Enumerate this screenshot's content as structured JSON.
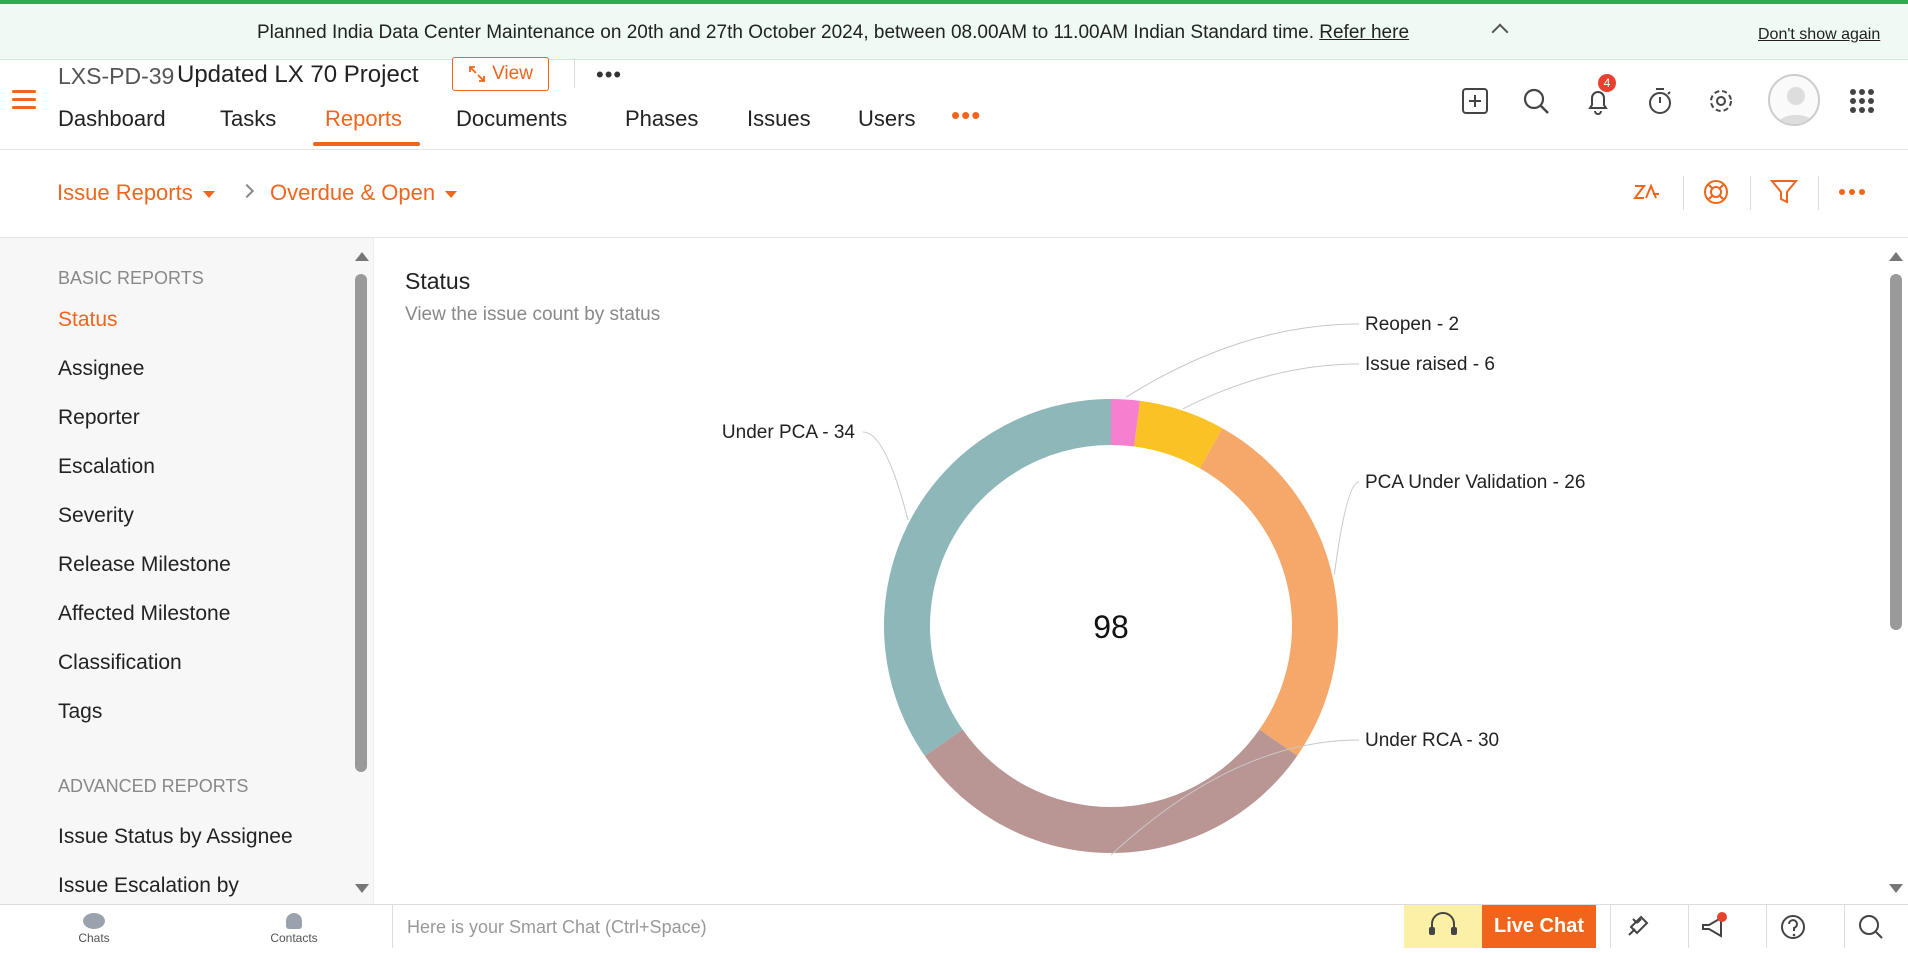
{
  "banner": {
    "message": "Planned India Data Center Maintenance on 20th and 27th October 2024, between 08.00AM to 11.00AM Indian Standard time.",
    "link": "Refer here",
    "dismiss": "Don't show again"
  },
  "header": {
    "project_id": "LXS-PD-39",
    "project_name": "Updated LX 70 Project",
    "view_label": "View",
    "nav": [
      "Dashboard",
      "Tasks",
      "Reports",
      "Documents",
      "Phases",
      "Issues",
      "Users"
    ],
    "active_nav": "Reports",
    "notification_count": "4"
  },
  "toolbar": {
    "breadcrumb": [
      "Issue Reports",
      "Overdue & Open"
    ]
  },
  "sidebar": {
    "basic_title": "BASIC REPORTS",
    "basic_items": [
      "Status",
      "Assignee",
      "Reporter",
      "Escalation",
      "Severity",
      "Release Milestone",
      "Affected Milestone",
      "Classification",
      "Tags"
    ],
    "active_item": "Status",
    "advanced_title": "ADVANCED REPORTS",
    "advanced_items": [
      "Issue Status by Assignee",
      "Issue Escalation by"
    ]
  },
  "main": {
    "title": "Status",
    "subtitle": "View the issue count by status"
  },
  "chart_data": {
    "type": "donut",
    "total": 98,
    "series": [
      {
        "name": "Reopen",
        "value": 2,
        "color": "#f77fcf",
        "label": "Reopen - 2"
      },
      {
        "name": "Issue raised",
        "value": 6,
        "color": "#fbc226",
        "label": "Issue raised - 6"
      },
      {
        "name": "PCA Under Validation",
        "value": 26,
        "color": "#f5a86a",
        "label": "PCA Under Validation - 26"
      },
      {
        "name": "Under RCA",
        "value": 30,
        "color": "#b99594",
        "label": "Under RCA - 30"
      },
      {
        "name": "Under PCA",
        "value": 34,
        "color": "#8db7b8",
        "label": "Under PCA - 34"
      }
    ]
  },
  "bottombar": {
    "chats": "Chats",
    "contacts": "Contacts",
    "smart_chat_placeholder": "Here is your Smart Chat (Ctrl+Space)",
    "live_chat": "Live Chat"
  },
  "icons": {
    "accent": "#f0651b"
  }
}
